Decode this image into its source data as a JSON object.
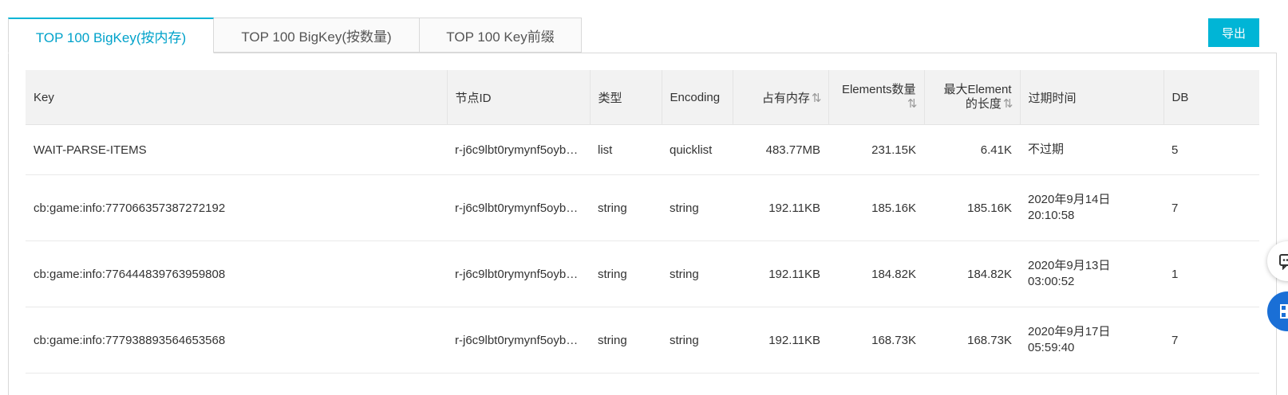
{
  "tabs": [
    {
      "label": "TOP 100 BigKey(按内存)",
      "active": true
    },
    {
      "label": "TOP 100 BigKey(按数量)",
      "active": false
    },
    {
      "label": "TOP 100 Key前缀",
      "active": false
    }
  ],
  "export_label": "导出",
  "columns": {
    "key": "Key",
    "node_id": "节点ID",
    "type": "类型",
    "encoding": "Encoding",
    "memory": "占有内存",
    "elements": "Elements数量",
    "max_element_len_1": "最大Element",
    "max_element_len_2": "的长度",
    "expire": "过期时间",
    "db": "DB"
  },
  "rows": [
    {
      "key": "WAIT-PARSE-ITEMS",
      "node_id": "r-j6c9lbt0rymynf5oyb…",
      "type": "list",
      "encoding": "quicklist",
      "memory": "483.77MB",
      "elements": "231.15K",
      "max_len": "6.41K",
      "expire_1": "不过期",
      "expire_2": "",
      "db": "5"
    },
    {
      "key": "cb:game:info:777066357387272192",
      "node_id": "r-j6c9lbt0rymynf5oyb…",
      "type": "string",
      "encoding": "string",
      "memory": "192.11KB",
      "elements": "185.16K",
      "max_len": "185.16K",
      "expire_1": "2020年9月14日",
      "expire_2": "20:10:58",
      "db": "7"
    },
    {
      "key": "cb:game:info:776444839763959808",
      "node_id": "r-j6c9lbt0rymynf5oyb…",
      "type": "string",
      "encoding": "string",
      "memory": "192.11KB",
      "elements": "184.82K",
      "max_len": "184.82K",
      "expire_1": "2020年9月13日",
      "expire_2": "03:00:52",
      "db": "1"
    },
    {
      "key": "cb:game:info:777938893564653568",
      "node_id": "r-j6c9lbt0rymynf5oyb…",
      "type": "string",
      "encoding": "string",
      "memory": "192.11KB",
      "elements": "168.73K",
      "max_len": "168.73K",
      "expire_1": "2020年9月17日",
      "expire_2": "05:59:40",
      "db": "7"
    }
  ],
  "icons": {
    "sort": "sort-icon",
    "chat": "chat-icon",
    "grid": "grid-icon"
  },
  "colors": {
    "accent": "#00b5d6",
    "float_blue": "#1a6fd6"
  }
}
